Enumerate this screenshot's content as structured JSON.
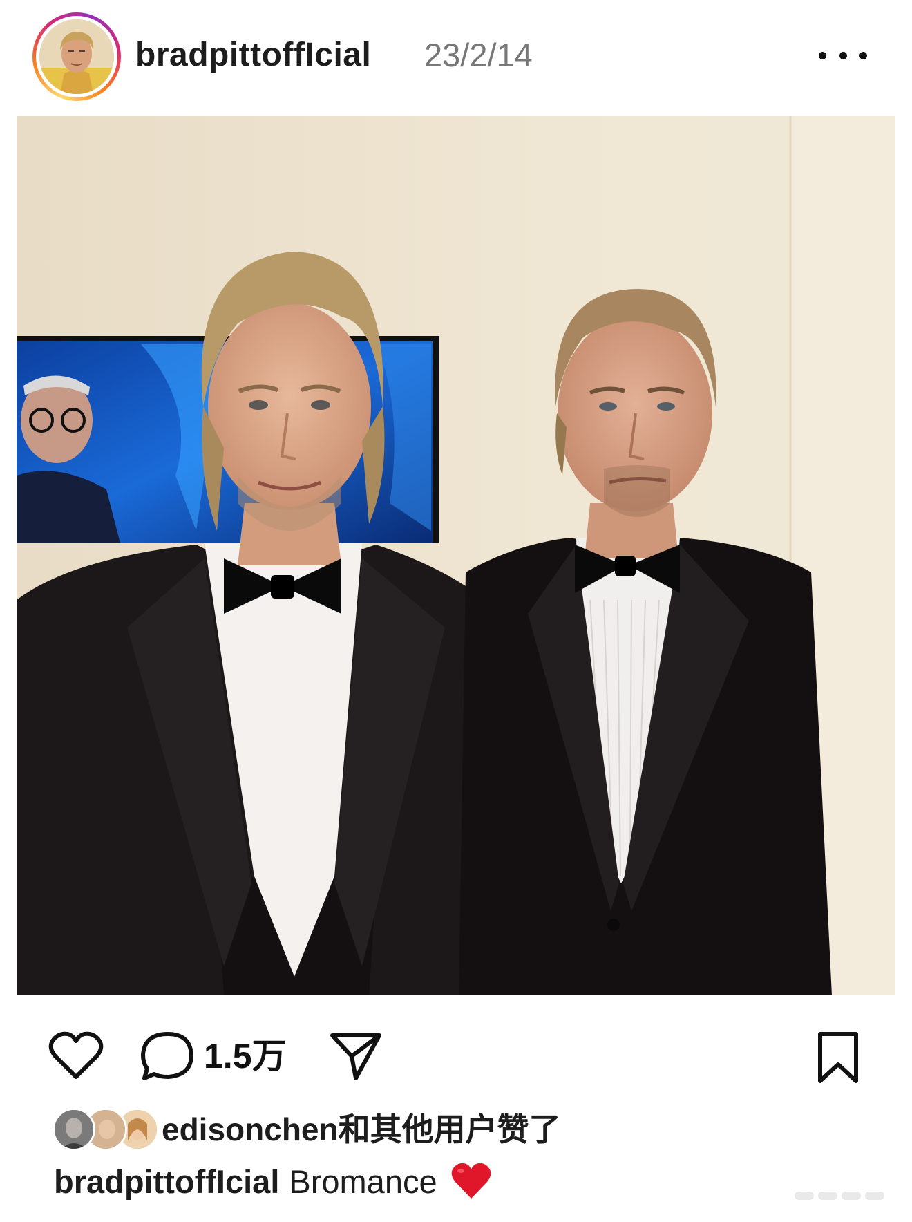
{
  "post": {
    "username": "bradpittoffIcial",
    "date": "23/2/14",
    "more_icon": "more-horizontal-icon"
  },
  "photo": {
    "tag_icon": "person-icon"
  },
  "actions": {
    "like_icon": "heart-outline-icon",
    "comment_icon": "comment-bubble-icon",
    "comment_count": "1.5万",
    "share_icon": "send-paper-plane-icon",
    "save_icon": "bookmark-icon"
  },
  "likes": {
    "liker_name": "edisonchen",
    "suffix": "和其他用户赞了"
  },
  "caption": {
    "username": "bradpittoffIcial",
    "text": "Bromance",
    "emoji_icon": "red-heart-emoji-icon"
  },
  "colors": {
    "ring_gradient": [
      "#feda75",
      "#fa7e1e",
      "#d62976",
      "#962fbf"
    ],
    "heart_red": "#e0162b",
    "date_gray": "#777777"
  }
}
